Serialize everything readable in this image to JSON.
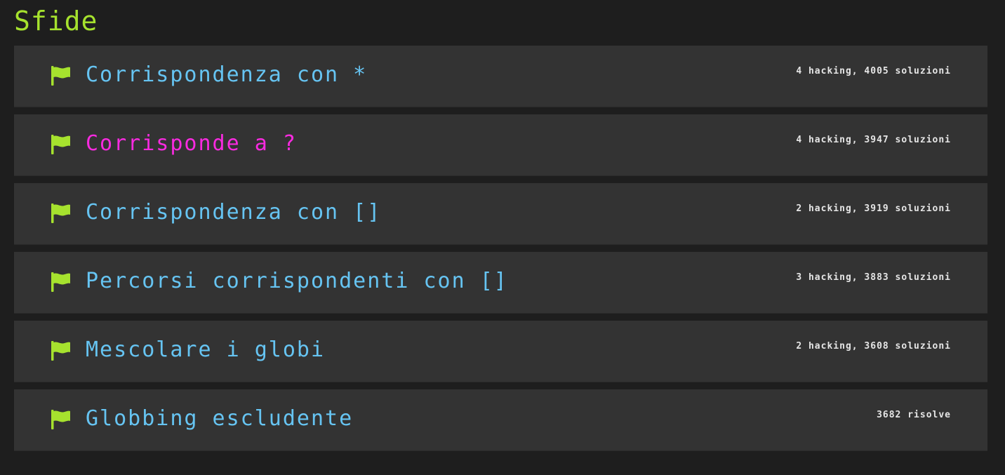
{
  "page": {
    "title": "Sfide"
  },
  "colors": {
    "background": "#1e1e1e",
    "row_background": "#333333",
    "title_green": "#a6e22e",
    "link_blue": "#66c4f2",
    "link_visited_magenta": "#f92ae0",
    "meta_text": "#e6e6e6",
    "flag_green": "#a6e22e"
  },
  "challenges": [
    {
      "title": "Corrispondenza con *",
      "meta": "4 hacking, 4005 soluzioni",
      "icon": "flag-icon",
      "color": "#66c4f2"
    },
    {
      "title": "Corrisponde a ?",
      "meta": "4 hacking, 3947 soluzioni",
      "icon": "flag-icon",
      "color": "#f92ae0"
    },
    {
      "title": "Corrispondenza con []",
      "meta": "2 hacking, 3919 soluzioni",
      "icon": "flag-icon",
      "color": "#66c4f2"
    },
    {
      "title": "Percorsi corrispondenti con []",
      "meta": "3 hacking, 3883 soluzioni",
      "icon": "flag-icon",
      "color": "#66c4f2"
    },
    {
      "title": "Mescolare i globi",
      "meta": "2 hacking, 3608 soluzioni",
      "icon": "flag-icon",
      "color": "#66c4f2"
    },
    {
      "title": "Globbing escludente",
      "meta": "3682 risolve",
      "icon": "flag-icon",
      "color": "#66c4f2"
    }
  ]
}
